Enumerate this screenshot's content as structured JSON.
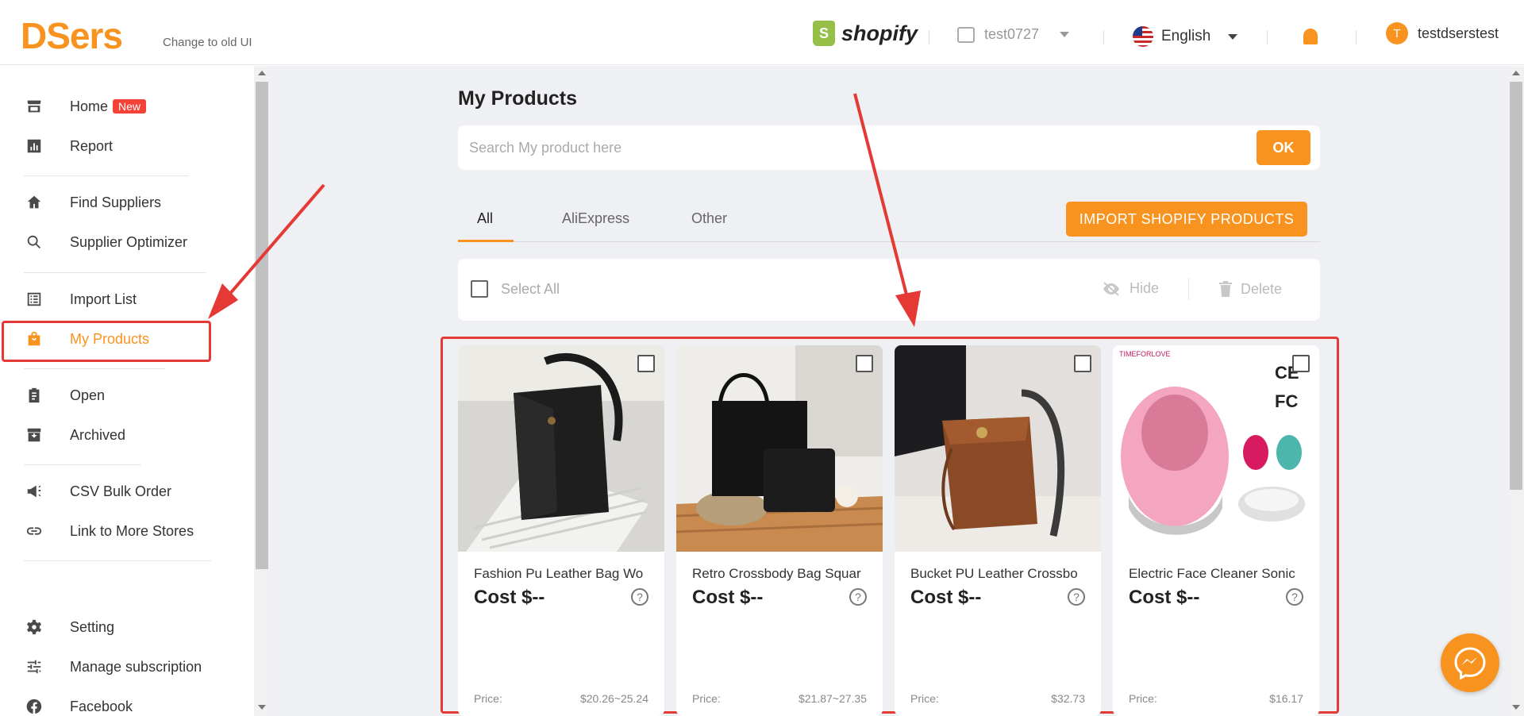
{
  "header": {
    "logo": "DSers",
    "old_ui_link": "Change to old UI",
    "platform": "shopify",
    "store_name": "test0727",
    "language": "English",
    "avatar_initial": "T",
    "username": "testdserstest"
  },
  "sidebar": {
    "items": [
      {
        "label": "Home",
        "icon": "store-icon",
        "badge": "New"
      },
      {
        "label": "Report",
        "icon": "chart-icon"
      },
      {
        "label": "Find Suppliers",
        "icon": "home-icon"
      },
      {
        "label": "Supplier Optimizer",
        "icon": "search-icon"
      },
      {
        "label": "Import List",
        "icon": "list-icon"
      },
      {
        "label": "My Products",
        "icon": "bag-icon",
        "active": true
      },
      {
        "label": "Open",
        "icon": "clipboard-icon"
      },
      {
        "label": "Archived",
        "icon": "archive-icon"
      },
      {
        "label": "CSV Bulk Order",
        "icon": "megaphone-icon"
      },
      {
        "label": "Link to More Stores",
        "icon": "link-icon"
      },
      {
        "label": "Setting",
        "icon": "gear-icon"
      },
      {
        "label": "Manage subscription",
        "icon": "sliders-icon"
      },
      {
        "label": "Facebook",
        "icon": "facebook-icon"
      }
    ]
  },
  "main": {
    "title": "My Products",
    "search_placeholder": "Search My product here",
    "ok_label": "OK",
    "tabs": [
      {
        "label": "All",
        "active": true
      },
      {
        "label": "AliExpress"
      },
      {
        "label": "Other"
      }
    ],
    "import_button": "IMPORT SHOPIFY PRODUCTS",
    "select_all": "Select All",
    "hide_label": "Hide",
    "delete_label": "Delete",
    "products": [
      {
        "title": "Fashion Pu Leather Bag Wo",
        "cost": "Cost $--",
        "price_label": "Price:",
        "price": "$20.26~25.24"
      },
      {
        "title": "Retro Crossbody Bag Squar",
        "cost": "Cost $--",
        "price_label": "Price:",
        "price": "$21.87~27.35"
      },
      {
        "title": "Bucket PU Leather Crossbo",
        "cost": "Cost $--",
        "price_label": "Price:",
        "price": "$32.73"
      },
      {
        "title": "Electric Face Cleaner Sonic",
        "cost": "Cost $--",
        "price_label": "Price:",
        "price": "$16.17"
      }
    ],
    "brand_mark": "TIMEFORLOVE",
    "cert_marks": [
      "CE",
      "FC"
    ]
  },
  "colors": {
    "accent": "#f7931e",
    "annotation": "#e53935",
    "shopify_green": "#95bf47"
  }
}
